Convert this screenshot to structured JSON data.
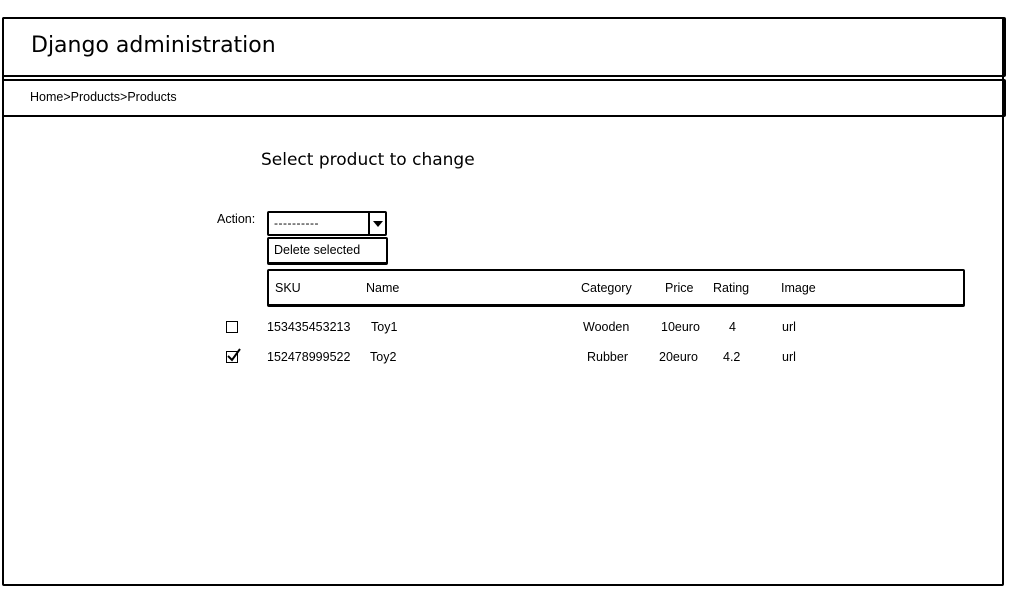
{
  "header": {
    "title": "Django administration"
  },
  "breadcrumb": {
    "items": [
      "Home",
      "Products",
      "Products"
    ],
    "separator": ">"
  },
  "content": {
    "title": "Select product to change",
    "action": {
      "label": "Action:",
      "selected": "----------",
      "options": [
        "Delete selected"
      ]
    }
  },
  "table": {
    "columns": [
      "SKU",
      "Name",
      "Category",
      "Price",
      "Rating",
      "Image"
    ],
    "rows": [
      {
        "checked": false,
        "sku": "153435453213",
        "name": "Toy1",
        "category": "Wooden",
        "price": "10euro",
        "rating": "4",
        "image": "url"
      },
      {
        "checked": true,
        "sku": "152478999522",
        "name": "Toy2",
        "category": "Rubber",
        "price": "20euro",
        "rating": "4.2",
        "image": "url"
      }
    ]
  }
}
